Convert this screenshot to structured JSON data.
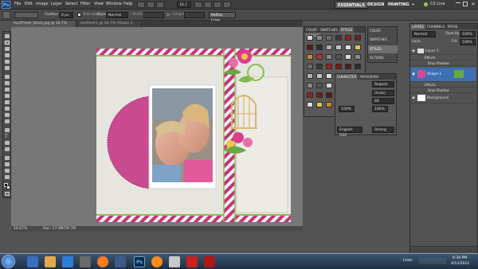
{
  "app": {
    "logo": "Ps",
    "menu": [
      "File",
      "Edit",
      "Image",
      "Layer",
      "Select",
      "Filter",
      "View",
      "Window",
      "Help"
    ],
    "zoom_select": "16.7",
    "workspaces": [
      "ESSENTIALS",
      "DESIGN",
      "PAINTING"
    ],
    "more": "»",
    "cslive": "CS Live"
  },
  "options": {
    "feather_label": "Feather:",
    "feather_value": "0 px",
    "antialias_label": "Anti-alias",
    "style_label": "Style:",
    "style_value": "Normal",
    "width_label": "Width:",
    "height_label": "Height:",
    "refine_edge": "Refine Edge..."
  },
  "tabs": [
    {
      "label": "AprilFresh_Stack.jpg @ 16.7% (Shape 1, RGB/8) *"
    },
    {
      "label": "Untitled-1 @ 16.7% (Shape 1, RGB/8) *"
    }
  ],
  "status": {
    "zoom": "16.67%",
    "doc": "Doc: 27.0M/59.7M"
  },
  "styles_panel": {
    "tabs": [
      "COLOR",
      "SWATCHES",
      "STYLES",
      "ACTIONS"
    ],
    "active": "STYLES"
  },
  "side_buttons": [
    "COLOR",
    "SWATCHES",
    "STYLES",
    "ACTIONS"
  ],
  "char_panel": {
    "tabs": [
      "CHARACTER",
      "PARAGRAPH"
    ],
    "font_style": "Regular",
    "leading": "(Auto)",
    "tracking": "60",
    "scale_v": "100%",
    "scale_h": "100%",
    "language": "English: USA",
    "antialias": "Strong"
  },
  "layers_panel": {
    "tabs": [
      "LAYERS",
      "CHANNELS",
      "PATHS"
    ],
    "blend": "Normal",
    "opacity_label": "Opacity:",
    "opacity": "100%",
    "lock_label": "Lock:",
    "fill_label": "Fill:",
    "fill": "100%",
    "layers": [
      {
        "name": "Layer 1",
        "fx": "Effects",
        "effect": "Drop Shadow"
      },
      {
        "name": "Shape 1",
        "fx": "Effects",
        "effect": "Drop Shadow"
      },
      {
        "name": "Background"
      }
    ]
  },
  "taskbar": {
    "time": "6:39 PM",
    "date": "4/12/2012",
    "links": "Links"
  },
  "colors": {
    "accent_pink": "#c2337b",
    "paper": "#e7e5df",
    "green": "#8cbf4b"
  }
}
